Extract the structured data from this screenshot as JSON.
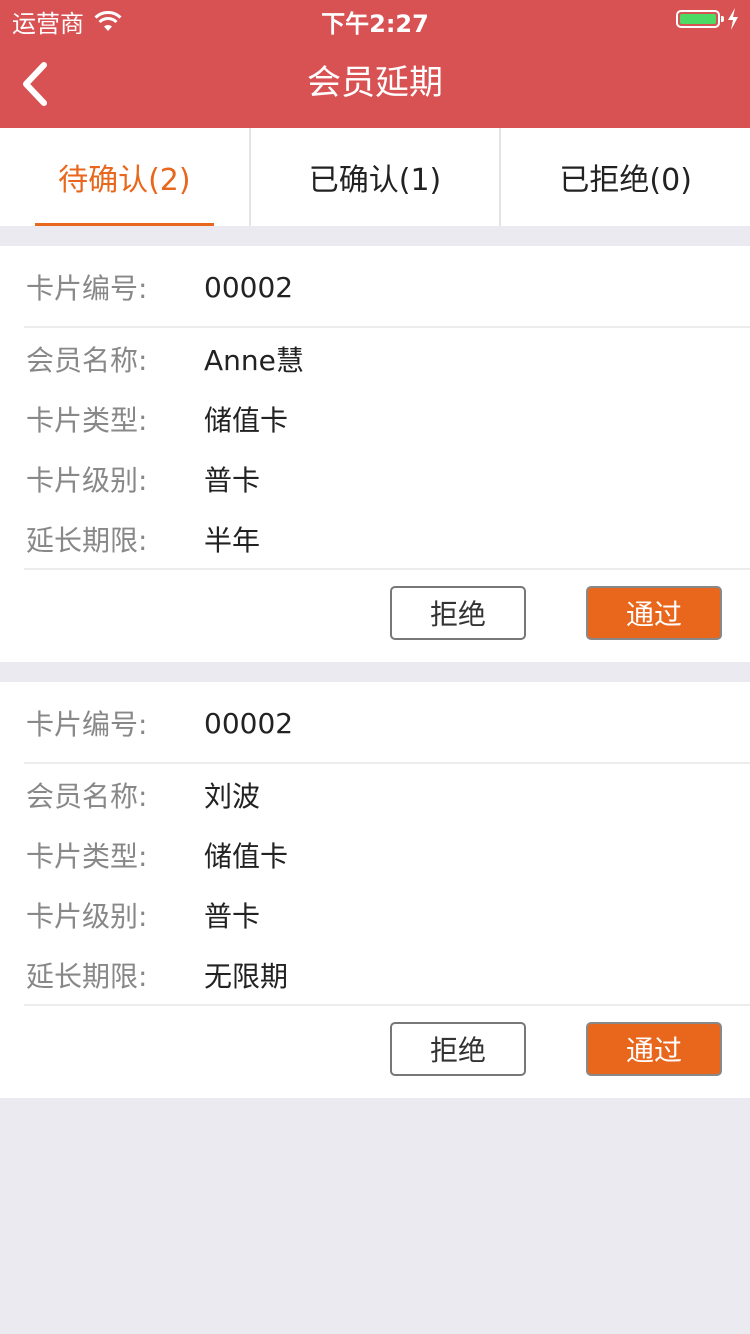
{
  "status_bar": {
    "carrier": "运营商",
    "time": "下午2:27",
    "battery_level": 1.0
  },
  "header": {
    "title": "会员延期",
    "back_icon": "chevron-left-icon"
  },
  "tabs": [
    {
      "label": "待确认(2)",
      "active": true
    },
    {
      "label": "已确认(1)",
      "active": false
    },
    {
      "label": "已拒绝(0)",
      "active": false
    }
  ],
  "cards": [
    {
      "card_no_label": "卡片编号:",
      "card_no": "00002",
      "member_name_label": "会员名称:",
      "member_name": "Anne慧",
      "card_type_label": "卡片类型:",
      "card_type": "储值卡",
      "card_level_label": "卡片级别:",
      "card_level": "普卡",
      "extend_label": "延长期限:",
      "extend": "半年",
      "reject_label": "拒绝",
      "approve_label": "通过"
    },
    {
      "card_no_label": "卡片编号:",
      "card_no": "00002",
      "member_name_label": "会员名称:",
      "member_name": "刘波",
      "card_type_label": "卡片类型:",
      "card_type": "储值卡",
      "card_level_label": "卡片级别:",
      "card_level": "普卡",
      "extend_label": "延长期限:",
      "extend": "无限期",
      "reject_label": "拒绝",
      "approve_label": "通过"
    }
  ],
  "colors": {
    "header_bg": "#d85153",
    "accent": "#e8671c",
    "page_bg": "#ebeaf0"
  }
}
